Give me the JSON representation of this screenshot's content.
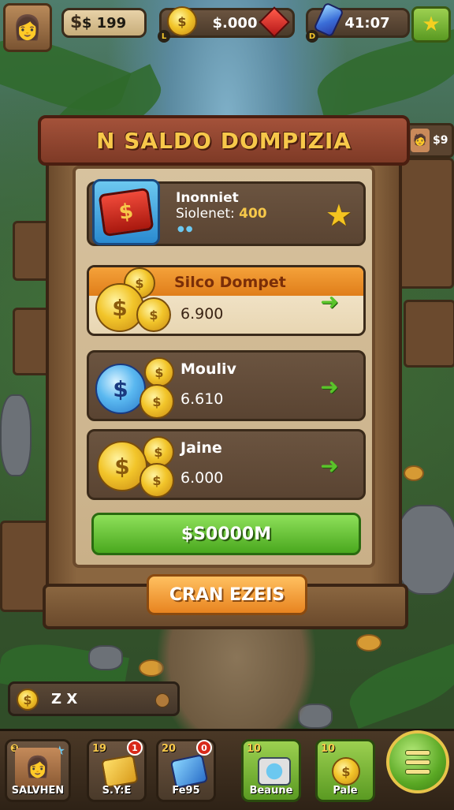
{
  "colors": {
    "title_text": "#f7c84a",
    "confirm_green": "#5ab82a",
    "cancel_orange": "#f09a2a",
    "panel_wood": "#8a6640"
  },
  "topbar": {
    "resource_1": {
      "icon": "dollar-icon",
      "value": "$ 199"
    },
    "resource_2": {
      "icon": "gold-coin-icon",
      "value": "$.000",
      "side_icon": "ruby-icon"
    },
    "resource_3": {
      "icon": "gem-icon",
      "value": "41:07"
    },
    "star_button": {
      "icon": "star-icon"
    }
  },
  "side_avatar": {
    "value": "$9"
  },
  "dialog": {
    "title": "N SALDO DOMPIZIA",
    "top_card": {
      "line1": "Inonniet",
      "line2_label": "Siolenet:",
      "line2_value": "400",
      "dots": "●●"
    },
    "options": [
      {
        "name": "Silco Dompet",
        "value": "6.900"
      },
      {
        "name": "Mouliv",
        "value": "6.610"
      },
      {
        "name": "Jaine",
        "value": "6.000"
      }
    ],
    "confirm_label": "$S0000M",
    "cancel_label": "CRAN EZEIS"
  },
  "infobar": {
    "text": "Z X"
  },
  "nav": [
    {
      "label": "SALVHEN",
      "type": "profile"
    },
    {
      "label": "S.Y:E",
      "num": "19",
      "badge": "1"
    },
    {
      "label": "Fe95",
      "num": "20",
      "badge": "0"
    },
    {
      "label": "Beaune",
      "num": "10"
    },
    {
      "label": "Pale",
      "num": "10"
    }
  ]
}
